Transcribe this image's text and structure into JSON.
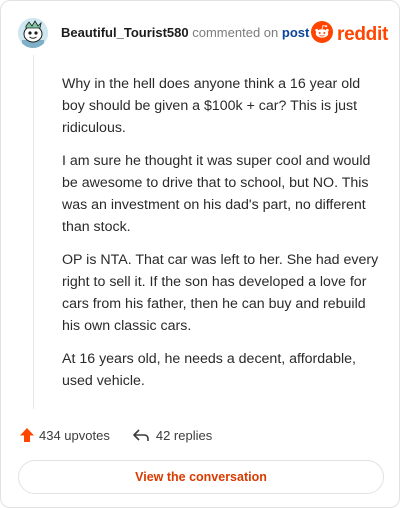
{
  "header": {
    "username": "Beautiful_Tourist580",
    "action_text": "commented on",
    "post_link": "post",
    "brand": "reddit",
    "avatar_icon": "snoo-avatar-icon",
    "logo_icon": "reddit-alien-icon"
  },
  "comment": {
    "paragraphs": [
      "Why in the hell does anyone think a 16 year old boy should be given a $100k + car? This is just ridiculous.",
      "I am sure he thought it was super cool and would be awesome to drive that to school, but NO. This was an investment on his dad's part, no different than stock.",
      "OP is NTA. That car was left to her. She had every right to sell it. If the son has developed a love for cars from his father, then he can buy and rebuild his own classic cars.",
      "At 16 years old, he needs a decent, affordable, used vehicle."
    ]
  },
  "footer": {
    "upvotes": "434 upvotes",
    "replies": "42 replies",
    "upvote_icon": "upvote-arrow-icon",
    "reply_icon": "reply-arrow-icon"
  },
  "cta": {
    "label": "View the conversation"
  },
  "colors": {
    "brand": "#ff4500",
    "link": "#0a449b",
    "cta_text": "#d93a00"
  }
}
